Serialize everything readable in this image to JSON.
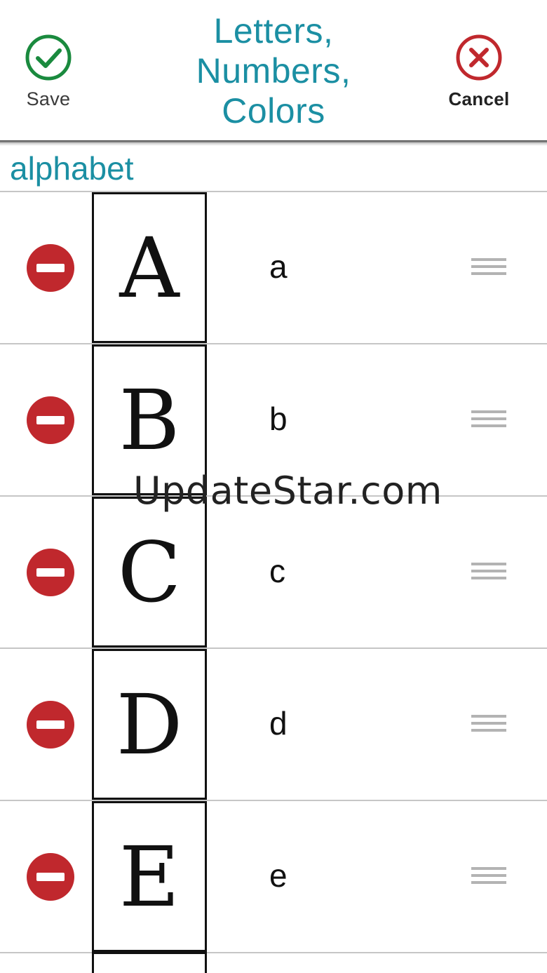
{
  "header": {
    "save_label": "Save",
    "cancel_label": "Cancel",
    "title_lines": [
      "Letters,",
      "Numbers,",
      "Colors"
    ],
    "accent_color": "#1b8fa3",
    "save_color": "#1a8a3e",
    "cancel_color": "#c0282d"
  },
  "section": {
    "label": "alphabet"
  },
  "rows": [
    {
      "upper": "A",
      "lower": "a"
    },
    {
      "upper": "B",
      "lower": "b"
    },
    {
      "upper": "C",
      "lower": "c"
    },
    {
      "upper": "D",
      "lower": "d"
    },
    {
      "upper": "E",
      "lower": "e"
    }
  ],
  "icons": {
    "save": "check-circle-icon",
    "cancel": "x-circle-icon",
    "delete": "minus-circle-icon",
    "reorder": "drag-handle-icon"
  },
  "watermark": "UpdateStar.com"
}
